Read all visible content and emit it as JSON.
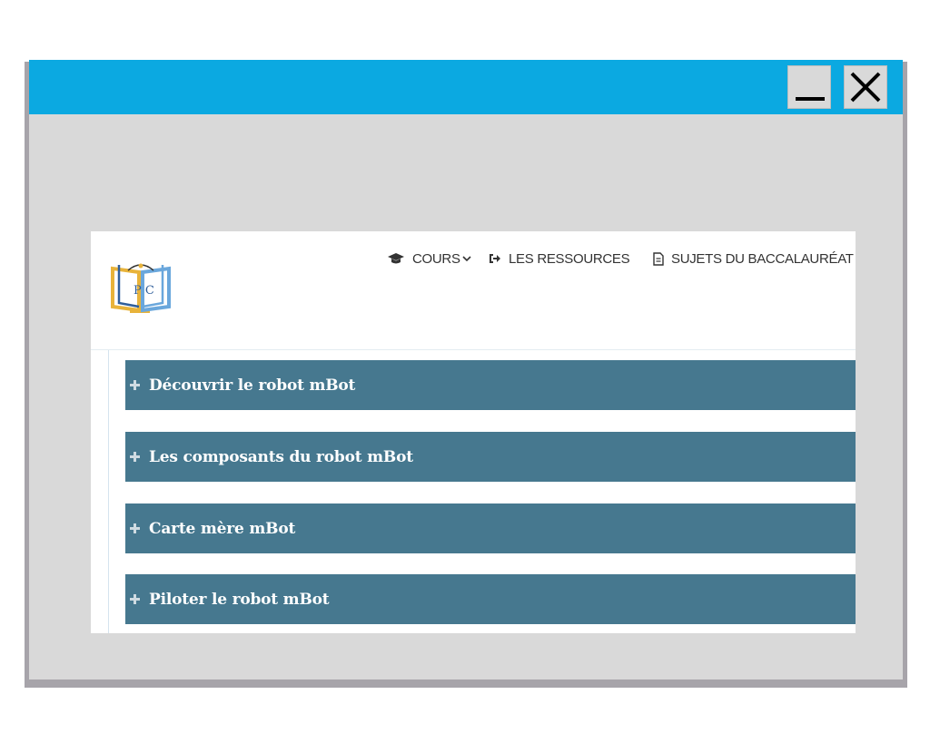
{
  "window": {
    "titlebar_color": "#0ba9e1",
    "minimize_icon": "minimize-icon",
    "close_icon": "close-icon"
  },
  "site": {
    "logo_text": "P C",
    "nav": {
      "cours": {
        "label": "COURS",
        "icon": "graduation-cap-icon",
        "dropdown_icon": "chevron-down-icon"
      },
      "ressources": {
        "label": "LES RESSOURCES",
        "icon": "sign-out-icon"
      },
      "bac": {
        "label": "SUJETS DU BACCALAURÉAT",
        "icon": "document-icon"
      }
    }
  },
  "sections": [
    {
      "label": "Découvrir le robot mBot"
    },
    {
      "label": "Les composants du robot mBot"
    },
    {
      "label": "Carte mère mBot"
    },
    {
      "label": "Piloter le robot mBot"
    }
  ],
  "colors": {
    "section_bar": "#46788f",
    "window_body": "#d9d9d9"
  }
}
